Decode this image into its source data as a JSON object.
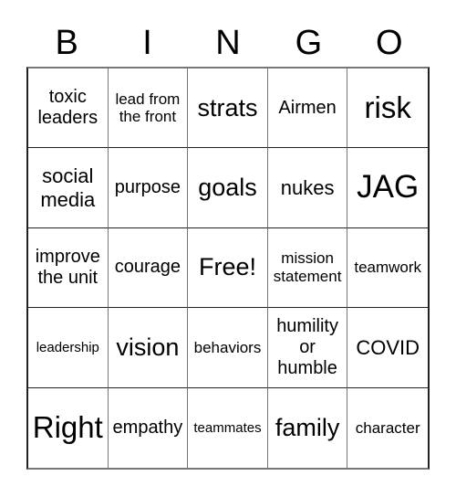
{
  "card": {
    "header": [
      "B",
      "I",
      "N",
      "G",
      "O"
    ],
    "cells": [
      {
        "label": "toxic leaders",
        "size": "m"
      },
      {
        "label": "lead from the front",
        "size": "s"
      },
      {
        "label": "strats",
        "size": "xl"
      },
      {
        "label": "Airmen",
        "size": "m"
      },
      {
        "label": "risk",
        "size": "xxl"
      },
      {
        "label": "social media",
        "size": "l"
      },
      {
        "label": "purpose",
        "size": "m"
      },
      {
        "label": "goals",
        "size": "xl"
      },
      {
        "label": "nukes",
        "size": "l"
      },
      {
        "label": "JAG",
        "size": "xxxl"
      },
      {
        "label": "improve the unit",
        "size": "m"
      },
      {
        "label": "courage",
        "size": "m"
      },
      {
        "label": "Free!",
        "size": "xl"
      },
      {
        "label": "mission statement",
        "size": "s"
      },
      {
        "label": "teamwork",
        "size": "s"
      },
      {
        "label": "leadership",
        "size": "xs"
      },
      {
        "label": "vision",
        "size": "xl"
      },
      {
        "label": "behaviors",
        "size": "s"
      },
      {
        "label": "humility or humble",
        "size": "m"
      },
      {
        "label": "COVID",
        "size": "l"
      },
      {
        "label": "Right",
        "size": "xxl"
      },
      {
        "label": "empathy",
        "size": "m"
      },
      {
        "label": "teammates",
        "size": "xs"
      },
      {
        "label": "family",
        "size": "xl"
      },
      {
        "label": "character",
        "size": "s"
      }
    ]
  }
}
